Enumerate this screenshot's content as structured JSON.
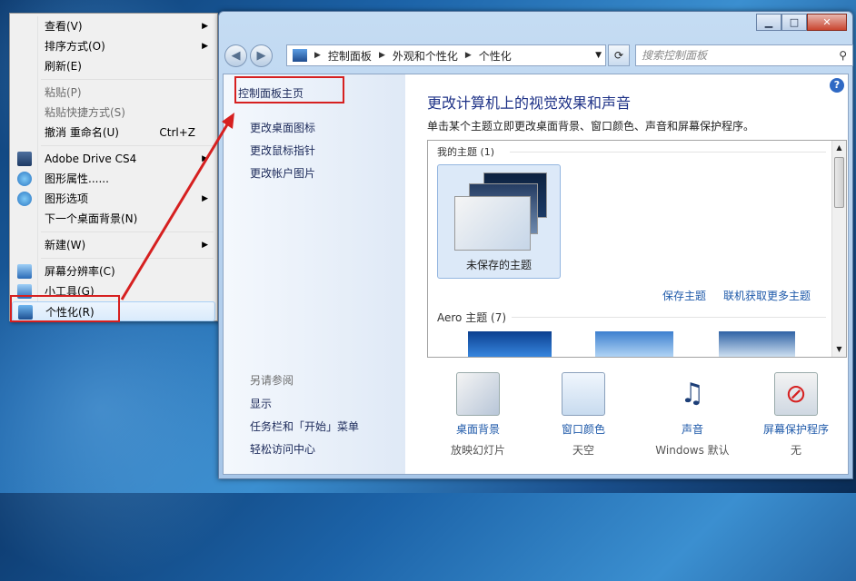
{
  "context_menu": {
    "items": [
      {
        "label": "查看(V)",
        "submenu": true
      },
      {
        "label": "排序方式(O)",
        "submenu": true
      },
      {
        "label": "刷新(E)"
      },
      {
        "label": "粘贴(P)",
        "disabled": true
      },
      {
        "label": "粘贴快捷方式(S)",
        "disabled": true
      },
      {
        "label": "撤消 重命名(U)",
        "shortcut": "Ctrl+Z"
      },
      {
        "label": "Adobe Drive CS4",
        "submenu": true
      },
      {
        "label": "图形属性......"
      },
      {
        "label": "图形选项",
        "submenu": true
      },
      {
        "label": "下一个桌面背景(N)"
      },
      {
        "label": "新建(W)",
        "submenu": true
      },
      {
        "label": "屏幕分辨率(C)"
      },
      {
        "label": "小工具(G)"
      },
      {
        "label": "个性化(R)"
      }
    ]
  },
  "window": {
    "address": {
      "crumbs": [
        "控制面板",
        "外观和个性化",
        "个性化"
      ]
    },
    "search_placeholder": "搜索控制面板",
    "left_pane": {
      "home": "控制面板主页",
      "links": [
        "更改桌面图标",
        "更改鼠标指针",
        "更改帐户图片"
      ],
      "see_also_header": "另请参阅",
      "see_also": [
        "显示",
        "任务栏和「开始」菜单",
        "轻松访问中心"
      ]
    },
    "main": {
      "title": "更改计算机上的视觉效果和声音",
      "description": "单击某个主题立即更改桌面背景、窗口颜色、声音和屏幕保护程序。",
      "my_themes_header": "我的主题 (1)",
      "unsaved_theme": "未保存的主题",
      "save_theme": "保存主题",
      "get_more_themes": "联机获取更多主题",
      "aero_header": "Aero 主题 (7)",
      "options": [
        {
          "label": "桌面背景",
          "sub": "放映幻灯片"
        },
        {
          "label": "窗口颜色",
          "sub": "天空"
        },
        {
          "label": "声音",
          "sub": "Windows 默认"
        },
        {
          "label": "屏幕保护程序",
          "sub": "无"
        }
      ]
    }
  },
  "colors": {
    "accent_red": "#d62020",
    "link_blue": "#1f5aaa",
    "title_blue": "#1e3287"
  }
}
